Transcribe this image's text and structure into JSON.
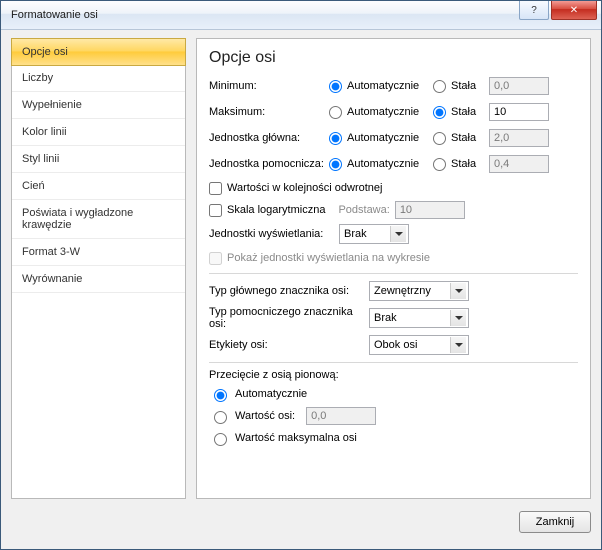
{
  "window": {
    "title": "Formatowanie osi"
  },
  "sidebar": {
    "items": [
      {
        "label": "Opcje osi"
      },
      {
        "label": "Liczby"
      },
      {
        "label": "Wypełnienie"
      },
      {
        "label": "Kolor linii"
      },
      {
        "label": "Styl linii"
      },
      {
        "label": "Cień"
      },
      {
        "label": "Poświata i wygładzone krawędzie"
      },
      {
        "label": "Format 3-W"
      },
      {
        "label": "Wyrównanie"
      }
    ],
    "selected_index": 0
  },
  "heading": "Opcje osi",
  "rows": {
    "minimum": {
      "label": "Minimum:",
      "auto": "Automatycznie",
      "fixed": "Stała",
      "value": "0,0",
      "mode": "auto"
    },
    "maximum": {
      "label": "Maksimum:",
      "auto": "Automatycznie",
      "fixed": "Stała",
      "value": "10",
      "mode": "fixed"
    },
    "major": {
      "label": "Jednostka główna:",
      "auto": "Automatycznie",
      "fixed": "Stała",
      "value": "2,0",
      "mode": "auto"
    },
    "minor": {
      "label": "Jednostka pomocnicza:",
      "auto": "Automatycznie",
      "fixed": "Stała",
      "value": "0,4",
      "mode": "auto"
    }
  },
  "checks": {
    "reverse": {
      "label": "Wartości w kolejności odwrotnej",
      "checked": false
    },
    "logscale": {
      "label": "Skala logarytmiczna",
      "checked": false,
      "base_label": "Podstawa:",
      "base_value": "10"
    }
  },
  "display_units": {
    "label": "Jednostki wyświetlania:",
    "value": "Brak"
  },
  "show_units_on_chart": {
    "label": "Pokaż jednostki wyświetlania na wykresie",
    "checked": false
  },
  "major_tick": {
    "label": "Typ głównego znacznika osi:",
    "value": "Zewnętrzny"
  },
  "minor_tick": {
    "label": "Typ pomocniczego znacznika osi:",
    "value": "Brak"
  },
  "axis_labels": {
    "label": "Etykiety osi:",
    "value": "Obok osi"
  },
  "crosses": {
    "group_label": "Przecięcie z osią pionową:",
    "auto": "Automatycznie",
    "at_value": "Wartość osi:",
    "at_value_v": "0,0",
    "at_max": "Wartość maksymalna osi",
    "mode": "auto"
  },
  "footer": {
    "close": "Zamknij"
  }
}
